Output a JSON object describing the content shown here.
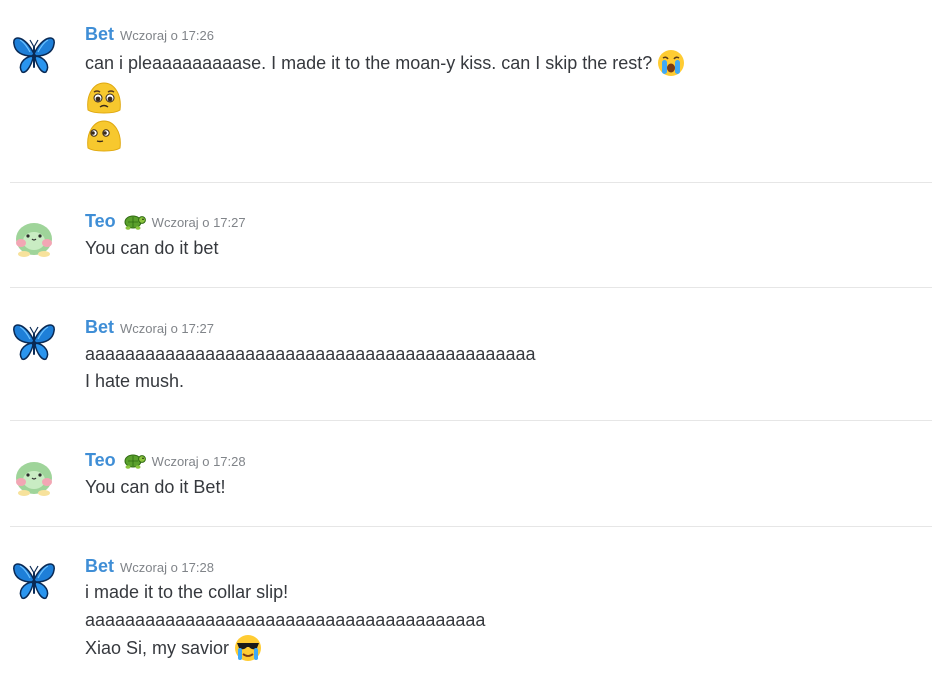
{
  "colors": {
    "username": "#3f8ed6",
    "timestamp": "#808489",
    "text": "#36393e",
    "divider": "#e6e6e6"
  },
  "messages": [
    {
      "author": "Bet",
      "avatar_icon": "butterfly-icon",
      "timestamp": "Wczoraj o 17:26",
      "lines": [
        "can i pleaaaaaaaaase. I made it to the moan-y kiss. can I skip the rest?"
      ],
      "inline_emoji": "loudly-crying-face-icon",
      "big_emojis": [
        "pleading-blob-icon",
        "shy-blob-icon"
      ]
    },
    {
      "author": "Teo",
      "avatar_icon": "frog-avatar-icon",
      "author_tag_icon": "turtle-icon",
      "timestamp": "Wczoraj o 17:27",
      "lines": [
        "You can do it bet"
      ]
    },
    {
      "author": "Bet",
      "avatar_icon": "butterfly-icon",
      "timestamp": "Wczoraj o 17:27",
      "lines": [
        "aaaaaaaaaaaaaaaaaaaaaaaaaaaaaaaaaaaaaaaaaaaaa",
        "I hate mush."
      ]
    },
    {
      "author": "Teo",
      "avatar_icon": "frog-avatar-icon",
      "author_tag_icon": "turtle-icon",
      "timestamp": "Wczoraj o 17:28",
      "lines": [
        "You can do it Bet!"
      ]
    },
    {
      "author": "Bet",
      "avatar_icon": "butterfly-icon",
      "timestamp": "Wczoraj o 17:28",
      "lines": [
        "i made it to the collar slip!",
        "aaaaaaaaaaaaaaaaaaaaaaaaaaaaaaaaaaaaaaaa",
        "Xiao Si, my savior"
      ],
      "inline_emoji": "cool-crying-face-icon"
    }
  ]
}
